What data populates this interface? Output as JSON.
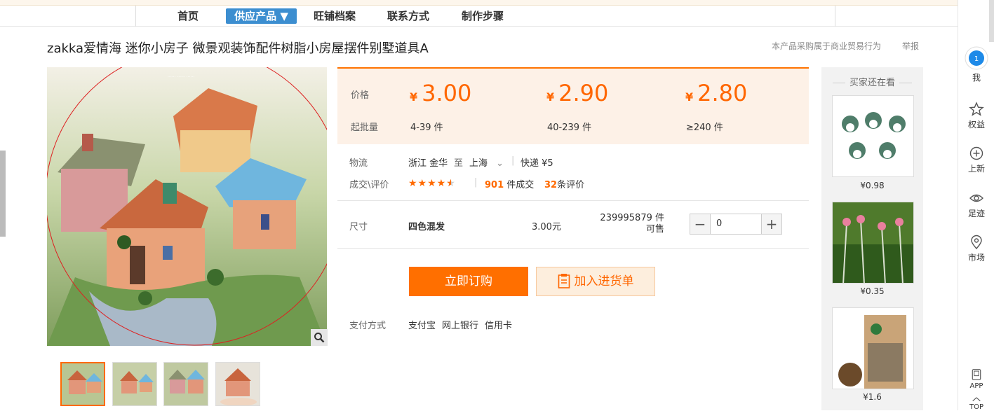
{
  "nav": {
    "items": [
      "首页",
      "供应产品 ▼",
      "旺铺档案",
      "联系方式",
      "制作步骤"
    ]
  },
  "product": {
    "title": "zakka爱情海 迷你小房子 微景观装饰配件树脂小房屋摆件别墅道具A"
  },
  "top_note": "本产品采购属于商业贸易行为",
  "report": "举报",
  "price_section": {
    "price_label": "价格",
    "moq_label": "起批量",
    "currency": "¥",
    "tiers": [
      {
        "price": "3.00",
        "range": "4-39  件"
      },
      {
        "price": "2.90",
        "range": "40-239  件"
      },
      {
        "price": "2.80",
        "range": "≥240  件"
      }
    ]
  },
  "logistics": {
    "label": "物流",
    "from": "浙江 金华",
    "to_word": "至",
    "dest": "上海",
    "express": "快递 ¥5"
  },
  "deal": {
    "label": "成交\\评价",
    "rating": 4.5,
    "deals_num": "901",
    "deals_suffix": "件成交",
    "reviews_num": "32",
    "reviews_suffix": "条评价"
  },
  "sku": {
    "label": "尺寸",
    "name": "四色混发",
    "price": "3.00元",
    "stock": "239995879 件可售",
    "quantity": "0"
  },
  "buttons": {
    "buy": "立即订购",
    "cart": "加入进货单"
  },
  "payment": {
    "label": "支付方式",
    "methods": [
      "支付宝",
      "网上银行",
      "信用卡"
    ]
  },
  "sidebar": {
    "title": "买家还在看",
    "items": [
      {
        "price": "¥0.98"
      },
      {
        "price": "¥0.35"
      },
      {
        "price": "¥1.6"
      }
    ]
  },
  "toolbar": {
    "items": [
      "我",
      "权益",
      "上新",
      "足迹",
      "市场",
      "APP",
      "TOP"
    ]
  },
  "image_text": {
    "watermark": "...... ...... ......"
  },
  "colors": {
    "accent": "#ff6600",
    "nav_active": "#3c8ed0",
    "price_bg": "#fdf1e7"
  }
}
